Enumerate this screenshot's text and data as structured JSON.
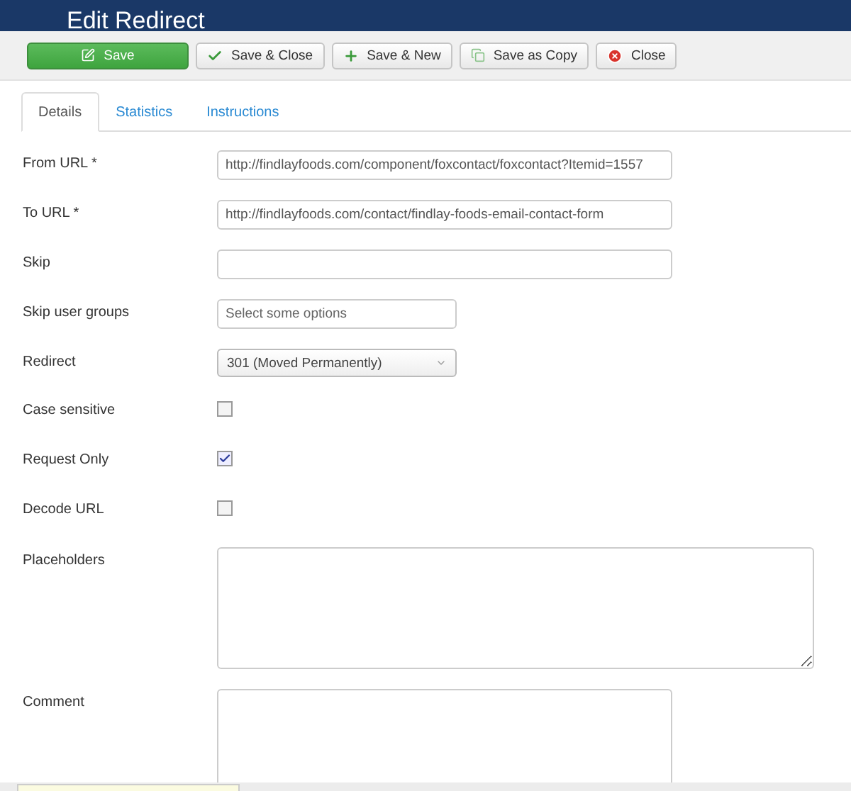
{
  "header": {
    "title": "Edit Redirect"
  },
  "toolbar": [
    {
      "label": "Save",
      "kind": "save"
    },
    {
      "label": "Save & Close",
      "kind": "check"
    },
    {
      "label": "Save & New",
      "kind": "new"
    },
    {
      "label": "Save as Copy",
      "kind": "copy"
    },
    {
      "label": "Close",
      "kind": "close"
    }
  ],
  "tabs": [
    {
      "label": "Details",
      "selected": true
    },
    {
      "label": "Statistics",
      "selected": false
    },
    {
      "label": "Instructions",
      "selected": false
    }
  ],
  "fields": [
    {
      "label": "From URL *",
      "kind": "text",
      "value": "http://findlayfoods.com/component/foxcontact/foxcontact?Itemid=1557"
    },
    {
      "label": "To URL *",
      "kind": "text",
      "value": "http://findlayfoods.com/contact/findlay-foods-email-contact-form"
    },
    {
      "label": "Skip",
      "kind": "text"
    },
    {
      "label": "Skip user groups",
      "kind": "multiselect",
      "placeholder": "Select some options"
    },
    {
      "label": "Redirect",
      "kind": "select",
      "value": "301 (Moved Permanently)"
    },
    {
      "label": "Case sensitive",
      "kind": "checkbox",
      "checked": false
    },
    {
      "label": "Request Only",
      "kind": "checkbox",
      "checked": true
    },
    {
      "label": "Decode URL",
      "kind": "checkbox",
      "checked": false
    },
    {
      "label": "Placeholders",
      "kind": "textarea",
      "wide": true
    },
    {
      "label": "Comment",
      "kind": "textarea",
      "wide": false
    }
  ]
}
